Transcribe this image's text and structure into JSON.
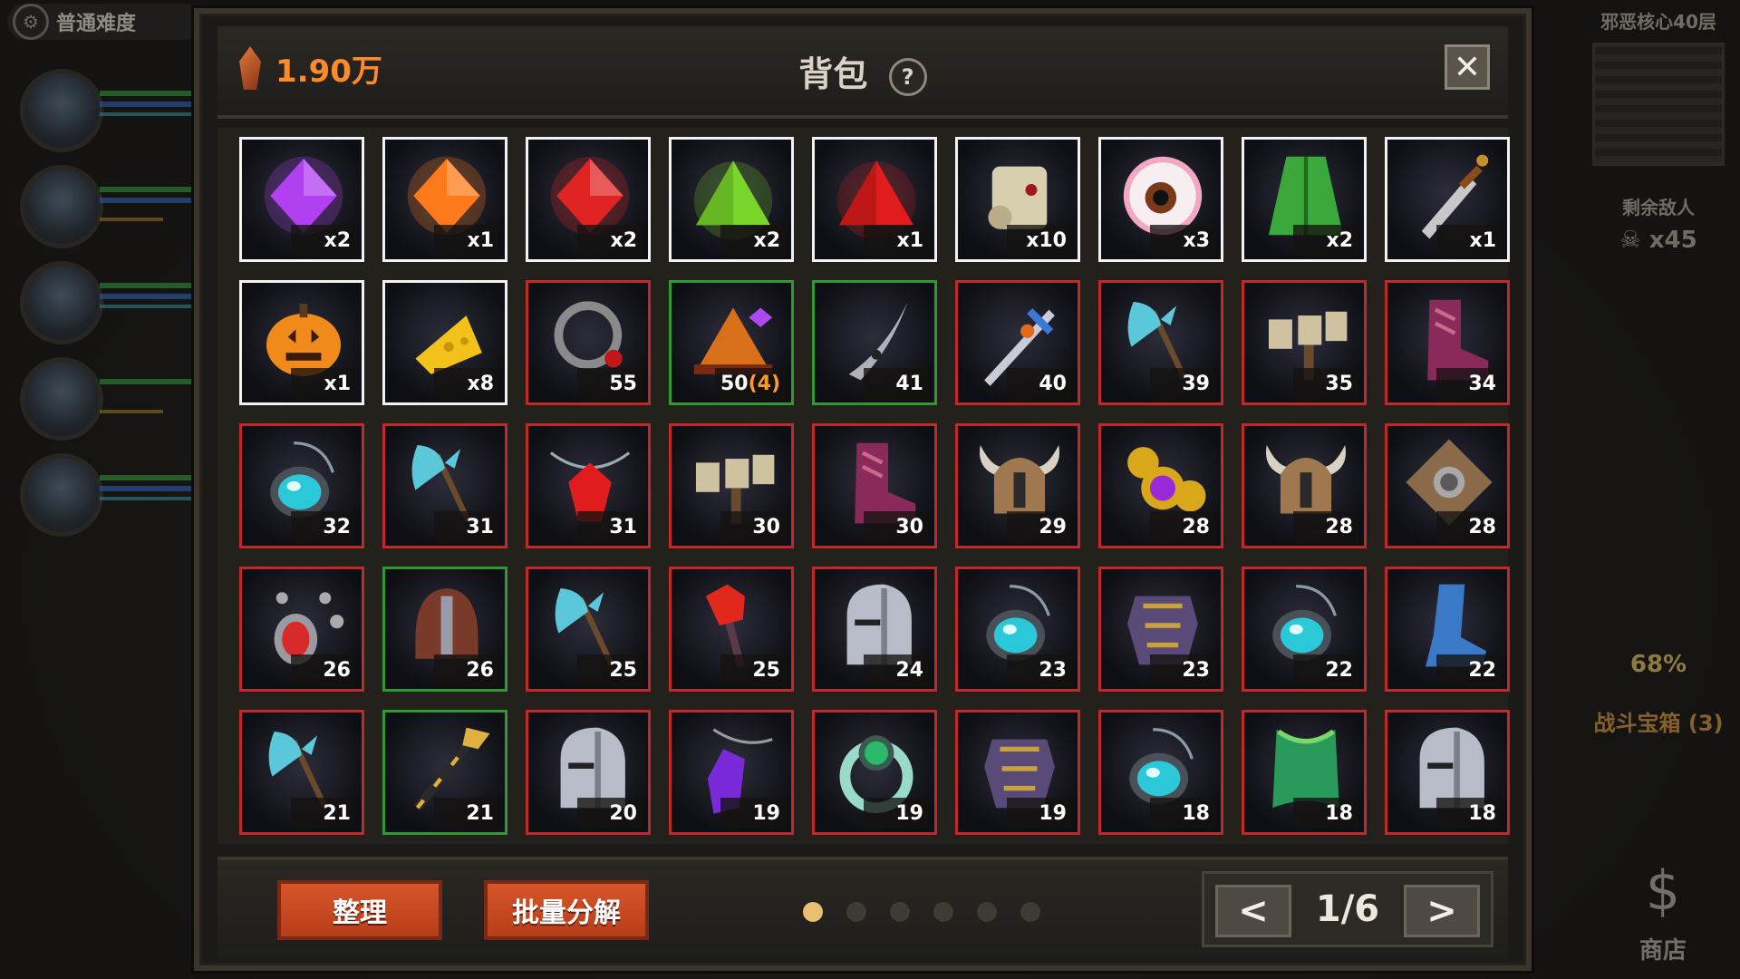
{
  "background": {
    "difficulty_label": "普通难度",
    "floor_title": "邪恶核心40层",
    "enemies_title": "剩余敌人",
    "enemies_count": "x45",
    "chest_percent": "68%",
    "chest_label": "战斗宝箱 (3)",
    "shop_label": "商店"
  },
  "backpack": {
    "currency": "1.90万",
    "title": "背包",
    "help_label": "?",
    "close_label": "✕",
    "sort_button": "整理",
    "bulk_decompose_button": "批量分解",
    "page_indicator": "1/6",
    "prev_label": "<",
    "next_label": ">",
    "page_dots": 6,
    "active_dot": 0
  },
  "items": [
    {
      "name": "purple-gem",
      "icon": "gem",
      "color": "#b040f0",
      "rarity": "white",
      "count": "x2"
    },
    {
      "name": "orange-gem",
      "icon": "gem",
      "color": "#ff7a1a",
      "rarity": "white",
      "count": "x1"
    },
    {
      "name": "red-gem",
      "icon": "gem",
      "color": "#e02424",
      "rarity": "white",
      "count": "x2"
    },
    {
      "name": "green-gem",
      "icon": "triangle-gem",
      "color": "#7ad62a",
      "rarity": "white",
      "count": "x2"
    },
    {
      "name": "red-triangle-gem",
      "icon": "triangle-gem",
      "color": "#e01c1c",
      "rarity": "white",
      "count": "x1"
    },
    {
      "name": "scroll",
      "icon": "scroll",
      "color": "#d8cfae",
      "rarity": "white",
      "count": "x10"
    },
    {
      "name": "eyeball",
      "icon": "eye",
      "color": "#f2a8c0",
      "rarity": "white",
      "count": "x3"
    },
    {
      "name": "green-cloak",
      "icon": "cloak",
      "color": "#3aa83a",
      "rarity": "white",
      "count": "x2"
    },
    {
      "name": "dagger",
      "icon": "dagger",
      "color": "#c8c8c8",
      "rarity": "white",
      "count": "x1"
    },
    {
      "name": "pumpkin",
      "icon": "pumpkin",
      "color": "#f08a1a",
      "rarity": "white",
      "count": "x1"
    },
    {
      "name": "cheese",
      "icon": "cheese",
      "color": "#f2c21a",
      "rarity": "white",
      "count": "x8"
    },
    {
      "name": "ring",
      "icon": "ring",
      "color": "#8a8a8a",
      "rarity": "red",
      "count": "55"
    },
    {
      "name": "wizard-hat",
      "icon": "hat",
      "color": "#d8701a",
      "rarity": "green",
      "count": "50",
      "extra": "(4)"
    },
    {
      "name": "curved-blade",
      "icon": "blade",
      "color": "#b0b0b8",
      "rarity": "green",
      "count": "41"
    },
    {
      "name": "sword",
      "icon": "sword",
      "color": "#3a78d8",
      "rarity": "red",
      "count": "40"
    },
    {
      "name": "battle-axe",
      "icon": "axe",
      "color": "#5ac8d8",
      "rarity": "red",
      "count": "39"
    },
    {
      "name": "hammer",
      "icon": "hammer",
      "color": "#cfc2a0",
      "rarity": "red",
      "count": "35"
    },
    {
      "name": "boots",
      "icon": "boot",
      "color": "#8a2a5a",
      "rarity": "red",
      "count": "34"
    },
    {
      "name": "amulet",
      "icon": "amulet",
      "color": "#2ac8d8",
      "rarity": "red",
      "count": "32"
    },
    {
      "name": "battle-axe",
      "icon": "axe",
      "color": "#5ac8d8",
      "rarity": "red",
      "count": "31"
    },
    {
      "name": "red-crystal-necklace",
      "icon": "crystal-necklace",
      "color": "#e01c1c",
      "rarity": "red",
      "count": "31"
    },
    {
      "name": "hammer",
      "icon": "hammer",
      "color": "#cfc2a0",
      "rarity": "red",
      "count": "30"
    },
    {
      "name": "boots",
      "icon": "boot",
      "color": "#8a2a5a",
      "rarity": "red",
      "count": "30"
    },
    {
      "name": "horned-helmet",
      "icon": "horned-helmet",
      "color": "#a07850",
      "rarity": "red",
      "count": "29"
    },
    {
      "name": "gold-necklace",
      "icon": "gold-necklace",
      "color": "#d8a81a",
      "rarity": "red",
      "count": "28"
    },
    {
      "name": "horned-helmet",
      "icon": "horned-helmet",
      "color": "#a07850",
      "rarity": "red",
      "count": "28"
    },
    {
      "name": "shield",
      "icon": "shield",
      "color": "#8a6a48",
      "rarity": "red",
      "count": "28"
    },
    {
      "name": "ruby-necklace",
      "icon": "ruby-necklace",
      "color": "#d82a2a",
      "rarity": "red",
      "count": "26"
    },
    {
      "name": "leather-helmet",
      "icon": "leather-helmet",
      "color": "#7a3a2a",
      "rarity": "green",
      "count": "26"
    },
    {
      "name": "battle-axe",
      "icon": "axe",
      "color": "#5ac8d8",
      "rarity": "red",
      "count": "25"
    },
    {
      "name": "fire-staff",
      "icon": "staff",
      "color": "#e0281c",
      "rarity": "red",
      "count": "25"
    },
    {
      "name": "knight-helmet",
      "icon": "knight-helmet",
      "color": "#b8bcc8",
      "rarity": "red",
      "count": "24"
    },
    {
      "name": "amulet",
      "icon": "amulet",
      "color": "#2ac8d8",
      "rarity": "red",
      "count": "23"
    },
    {
      "name": "chest-armor",
      "icon": "armor",
      "color": "#5a4a78",
      "rarity": "red",
      "count": "23"
    },
    {
      "name": "amulet",
      "icon": "amulet",
      "color": "#2ac8d8",
      "rarity": "red",
      "count": "22"
    },
    {
      "name": "blue-boots",
      "icon": "blue-boot",
      "color": "#3a78c8",
      "rarity": "red",
      "count": "22"
    },
    {
      "name": "battle-axe",
      "icon": "axe",
      "color": "#5ac8d8",
      "rarity": "red",
      "count": "21"
    },
    {
      "name": "golden-scepter",
      "icon": "scepter",
      "color": "#e0b040",
      "rarity": "green",
      "count": "21"
    },
    {
      "name": "knight-helmet",
      "icon": "knight-helmet",
      "color": "#b8bcc8",
      "rarity": "red",
      "count": "20"
    },
    {
      "name": "purple-crystal-pendant",
      "icon": "purple-pendant",
      "color": "#7a2ad8",
      "rarity": "red",
      "count": "19"
    },
    {
      "name": "emerald-ring",
      "icon": "emerald-ring",
      "color": "#2ab86a",
      "rarity": "red",
      "count": "19"
    },
    {
      "name": "chest-armor",
      "icon": "armor",
      "color": "#5a4a78",
      "rarity": "red",
      "count": "19"
    },
    {
      "name": "amulet",
      "icon": "amulet",
      "color": "#2ac8d8",
      "rarity": "red",
      "count": "18"
    },
    {
      "name": "green-cape",
      "icon": "cape",
      "color": "#2a9a5a",
      "rarity": "red",
      "count": "18"
    },
    {
      "name": "knight-helmet",
      "icon": "knight-helmet",
      "color": "#b8bcc8",
      "rarity": "red",
      "count": "18"
    }
  ]
}
